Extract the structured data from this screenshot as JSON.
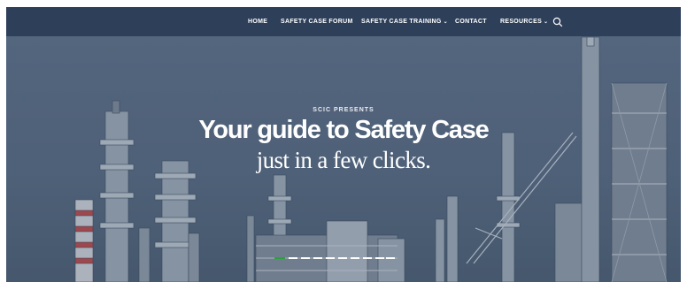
{
  "nav": {
    "items": [
      {
        "label": "HOME",
        "has_dropdown": false
      },
      {
        "label": "SAFETY CASE FORUM",
        "has_dropdown": false
      },
      {
        "label": "SAFETY CASE TRAINING",
        "has_dropdown": true
      },
      {
        "label": "CONTACT",
        "has_dropdown": false
      },
      {
        "label": "RESOURCES",
        "has_dropdown": true
      }
    ],
    "search_icon": "search-icon",
    "background": "#2d3f59"
  },
  "hero": {
    "eyebrow": "SCIC PRESENTS",
    "headline": "Your guide to Safety Case",
    "subheadline": "just in a few clicks.",
    "overlay_color": "#54677d",
    "slider": {
      "slide_count": 10,
      "active_index": 0,
      "active_color": "#2aa13a"
    }
  }
}
